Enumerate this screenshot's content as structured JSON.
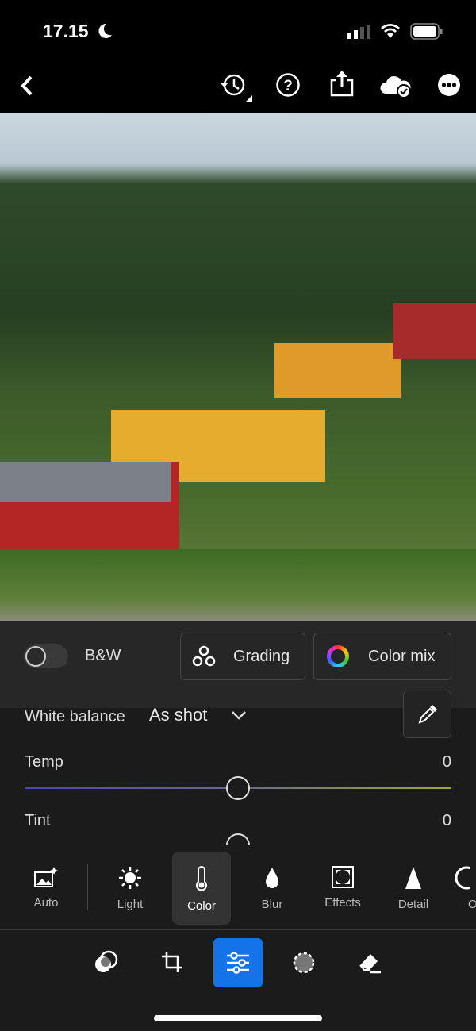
{
  "status": {
    "time": "17.15"
  },
  "toolbar": {
    "icons": [
      "chevron-left-icon",
      "history-icon",
      "help-icon",
      "share-icon",
      "cloud-synced-icon",
      "more-icon"
    ]
  },
  "panel": {
    "bw_label": "B&W",
    "bw_on": false,
    "grading_label": "Grading",
    "color_mix_label": "Color mix",
    "white_balance_label": "White balance",
    "white_balance_value": "As shot",
    "temp_label": "Temp",
    "temp_value": "0",
    "tint_label": "Tint",
    "tint_value": "0"
  },
  "tools": [
    {
      "label": "Auto"
    },
    {
      "label": "Light"
    },
    {
      "label": "Color",
      "selected": true
    },
    {
      "label": "Blur"
    },
    {
      "label": "Effects"
    },
    {
      "label": "Detail"
    },
    {
      "label": "O"
    }
  ],
  "nav": {
    "selected": "edit",
    "icons": [
      "presets-icon",
      "crop-icon",
      "edit-sliders-icon",
      "masking-icon",
      "healing-eraser-icon"
    ]
  },
  "colors": {
    "accent": "#1473e6"
  }
}
